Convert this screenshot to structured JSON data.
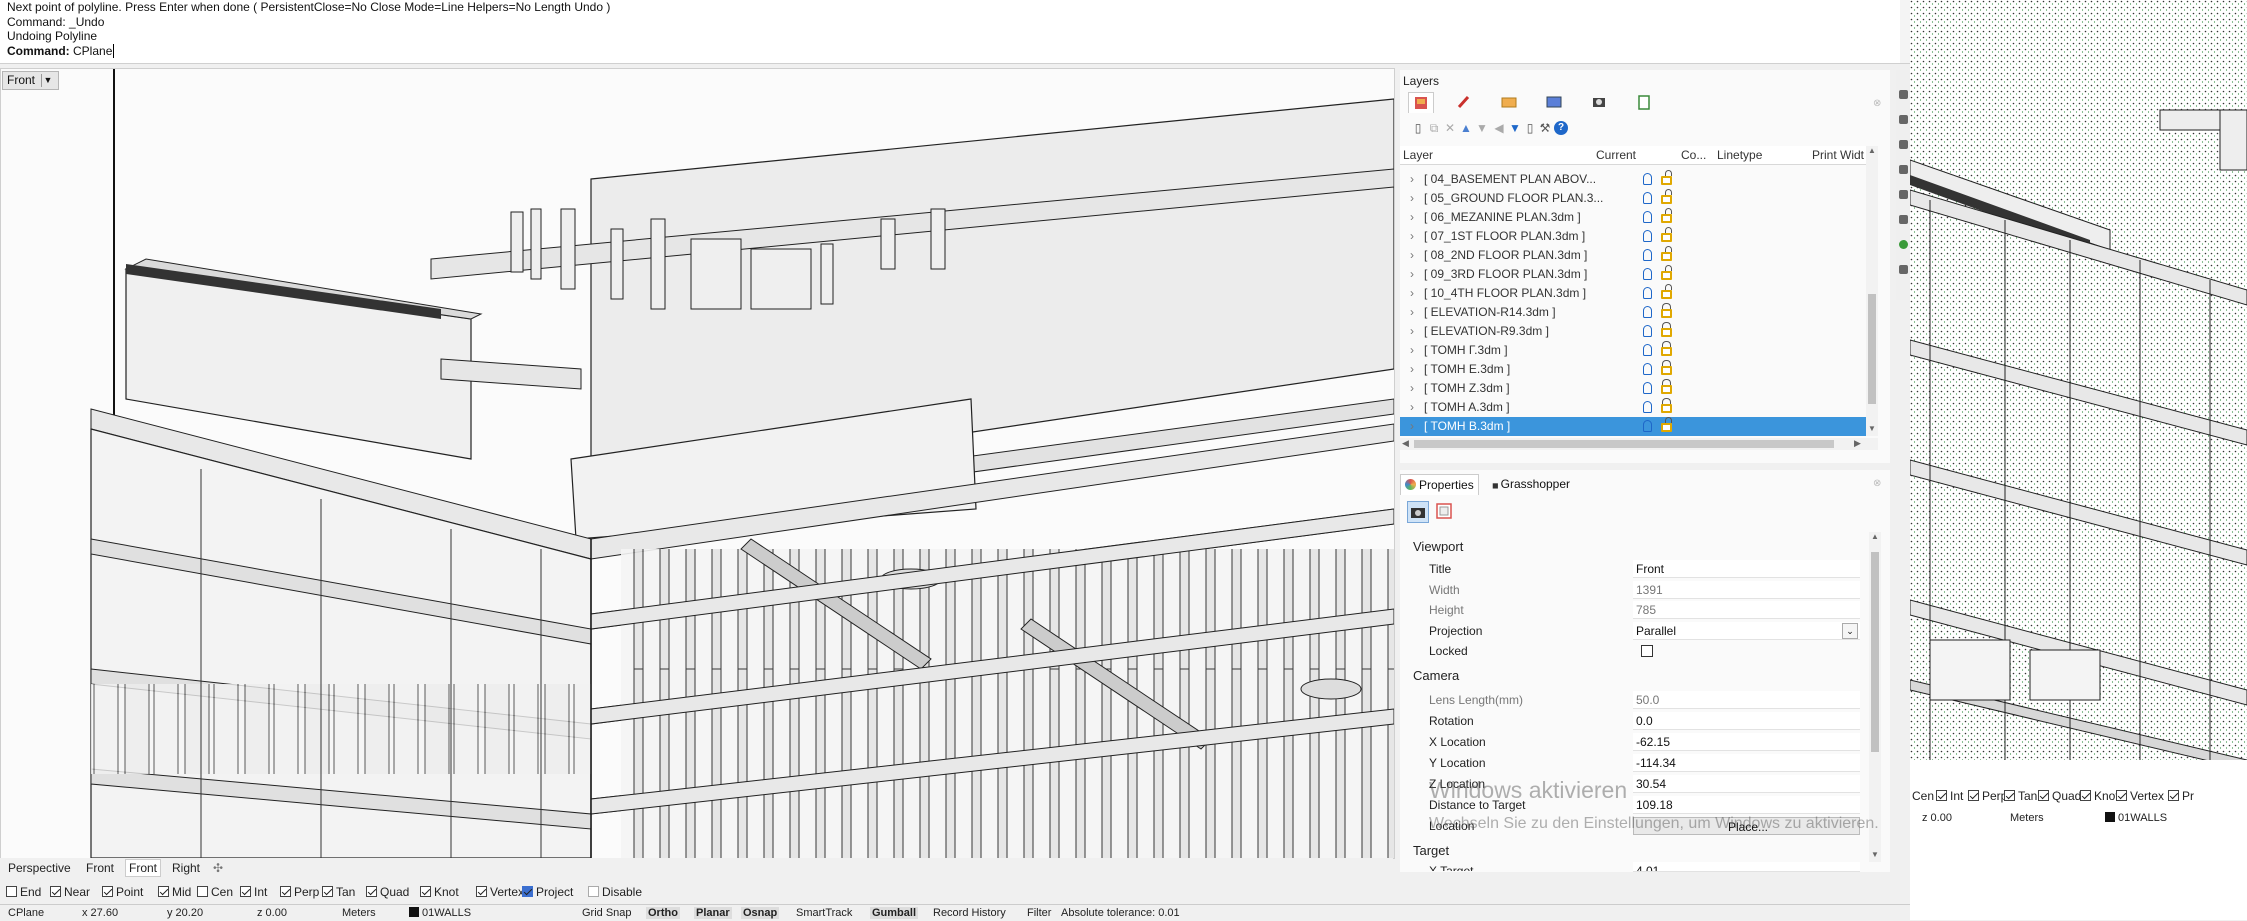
{
  "command": {
    "lines": [
      "Next point of polyline. Press Enter when done ( PersistentClose=No  Close  Mode=Line  Helpers=No  Length  Undo )",
      "Command: _Undo",
      "Undoing Polyline"
    ],
    "prompt_label": "Command:",
    "prompt_value": "CPlane"
  },
  "viewport": {
    "title": "Front",
    "dropdown_icon": "triangle-down-icon"
  },
  "layers": {
    "title": "Layers",
    "tab_icons": [
      "layers-icon",
      "brush-icon",
      "folder-icon",
      "monitor-icon",
      "camera-icon",
      "clipboard-icon"
    ],
    "toolbar_icons": [
      "new-layer-icon",
      "copy-icon",
      "delete-icon",
      "move-up-icon",
      "move-down-icon",
      "collapse-icon",
      "filter-icon",
      "new-sublayer-icon",
      "tools-icon",
      "help-icon"
    ],
    "columns": [
      "Layer",
      "Current",
      "Co...",
      "Linetype",
      "Print Widt"
    ],
    "rows": [
      {
        "name": "[ 04_BASEMENT PLAN ABOV...",
        "lock": "open",
        "selected": false
      },
      {
        "name": "[ 05_GROUND FLOOR PLAN.3...",
        "lock": "open",
        "selected": false
      },
      {
        "name": "[ 06_MEZANINE PLAN.3dm ]",
        "lock": "open",
        "selected": false
      },
      {
        "name": "[ 07_1ST FLOOR PLAN.3dm ]",
        "lock": "open",
        "selected": false
      },
      {
        "name": "[ 08_2ND FLOOR PLAN.3dm ]",
        "lock": "open",
        "selected": false
      },
      {
        "name": "[ 09_3RD FLOOR PLAN.3dm ]",
        "lock": "open",
        "selected": false
      },
      {
        "name": "[ 10_4TH FLOOR PLAN.3dm ]",
        "lock": "open",
        "selected": false
      },
      {
        "name": "[ ELEVATION-R14.3dm ]",
        "lock": "closed",
        "selected": false
      },
      {
        "name": "[ ELEVATION-R9.3dm ]",
        "lock": "closed",
        "selected": false
      },
      {
        "name": "[ TOMH Γ.3dm ]",
        "lock": "closed",
        "selected": false
      },
      {
        "name": "[ TOMH E.3dm ]",
        "lock": "closed",
        "selected": false
      },
      {
        "name": "[ TOMH Z.3dm ]",
        "lock": "closed",
        "selected": false
      },
      {
        "name": "[ TOMH A.3dm ]",
        "lock": "closed",
        "selected": false
      },
      {
        "name": "[ TOMH B.3dm ]",
        "lock": "open",
        "selected": true
      }
    ]
  },
  "properties": {
    "tabs": [
      "Properties",
      "Grasshopper"
    ],
    "sections": {
      "viewport": "Viewport",
      "camera": "Camera",
      "target": "Target"
    },
    "viewport_fields": [
      {
        "label": "Title",
        "value": "Front",
        "dim": false
      },
      {
        "label": "Width",
        "value": "1391",
        "dim": true
      },
      {
        "label": "Height",
        "value": "785",
        "dim": true
      },
      {
        "label": "Projection",
        "value": "Parallel",
        "dim": false
      },
      {
        "label": "Locked",
        "value": "",
        "dim": false
      }
    ],
    "camera_fields": [
      {
        "label": "Lens Length(mm)",
        "value": "50.0",
        "dim": true
      },
      {
        "label": "Rotation",
        "value": "0.0",
        "dim": false
      },
      {
        "label": "X Location",
        "value": "-62.15",
        "dim": false
      },
      {
        "label": "Y Location",
        "value": "-114.34",
        "dim": false
      },
      {
        "label": "Z Location",
        "value": "30.54",
        "dim": false
      },
      {
        "label": "Distance to Target",
        "value": "109.18",
        "dim": false
      },
      {
        "label": "Location",
        "value": "Place...",
        "dim": false
      }
    ],
    "target_partial_label": "X Target",
    "target_partial_value": "4.01"
  },
  "watermark": {
    "line1": "Windows aktivieren",
    "line2": "Wechseln Sie zu den Einstellungen, um Windows zu aktivieren."
  },
  "view_tabs": [
    "Perspective",
    "Front",
    "Front",
    "Right"
  ],
  "view_tabs_add_icon": "plus-icon",
  "osnaps": [
    {
      "label": "End",
      "on": false
    },
    {
      "label": "Near",
      "on": true
    },
    {
      "label": "Point",
      "on": true
    },
    {
      "label": "Mid",
      "on": true
    },
    {
      "label": "Cen",
      "on": false
    },
    {
      "label": "Int",
      "on": true
    },
    {
      "label": "Perp",
      "on": true
    },
    {
      "label": "Tan",
      "on": true
    },
    {
      "label": "Quad",
      "on": true
    },
    {
      "label": "Knot",
      "on": true
    },
    {
      "label": "Vertex",
      "on": true
    },
    {
      "label": "Project",
      "on": true
    },
    {
      "label": "Disable",
      "on": false
    }
  ],
  "status": {
    "cplane": "CPlane",
    "x": "x 27.60",
    "y": "y 20.20",
    "z": "z 0.00",
    "units": "Meters",
    "layer": "01WALLS",
    "grid_snap": "Grid Snap",
    "ortho": "Ortho",
    "planar": "Planar",
    "osnap": "Osnap",
    "smarttrack": "SmartTrack",
    "gumball": "Gumball",
    "record_history": "Record History",
    "filter": "Filter",
    "tolerance": "Absolute tolerance: 0.01"
  },
  "right_window": {
    "osnaps": [
      "Cen",
      "Int",
      "Perp",
      "Tan",
      "Quad",
      "Knot",
      "Vertex",
      "Pr"
    ],
    "coord": "z 0.00",
    "units": "Meters",
    "layer": "01WALLS"
  },
  "colors": {
    "selection": "#3b95dc",
    "lock": "#e0a800",
    "bulb": "#1e67c9"
  }
}
